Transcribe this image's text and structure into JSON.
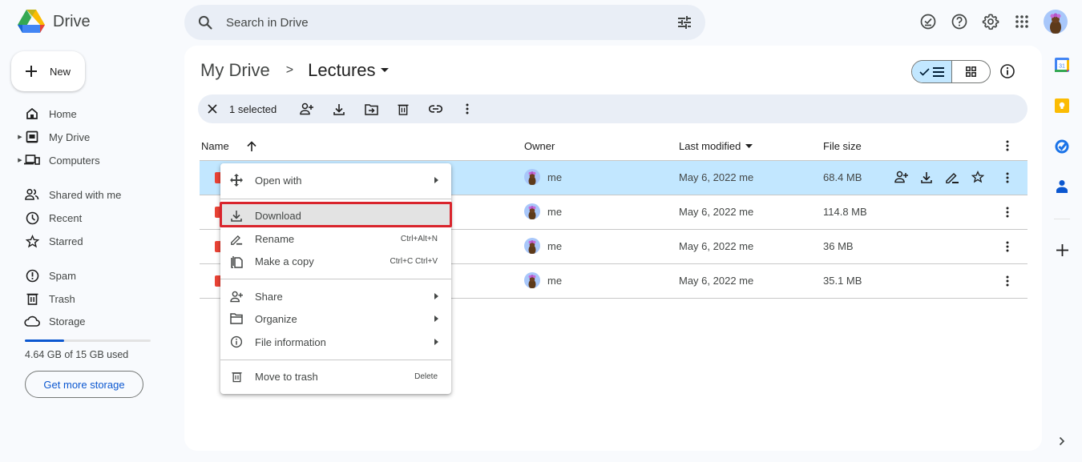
{
  "app": {
    "name": "Drive",
    "icons": {
      "logo": "google-drive-logo",
      "search": "search-icon",
      "filter": "tune-icon",
      "ready_offline": "offline-check-icon",
      "help": "help-icon",
      "settings": "gear-icon",
      "apps": "apps-grid-icon",
      "account": "avatar"
    }
  },
  "search": {
    "placeholder": "Search in Drive"
  },
  "sidebar": {
    "new_label": "New",
    "items": [
      {
        "label": "Home",
        "icon": "home-icon",
        "expandable": false
      },
      {
        "label": "My Drive",
        "icon": "my-drive-icon",
        "expandable": true
      },
      {
        "label": "Computers",
        "icon": "computers-icon",
        "expandable": true
      },
      {
        "label": "Shared with me",
        "icon": "shared-icon",
        "expandable": false
      },
      {
        "label": "Recent",
        "icon": "clock-icon",
        "expandable": false
      },
      {
        "label": "Starred",
        "icon": "star-icon",
        "expandable": false
      },
      {
        "label": "Spam",
        "icon": "spam-icon",
        "expandable": false
      },
      {
        "label": "Trash",
        "icon": "trash-icon",
        "expandable": false
      },
      {
        "label": "Storage",
        "icon": "cloud-icon",
        "expandable": false
      }
    ],
    "storage": {
      "used_fraction": 0.309,
      "text": "4.64 GB of 15 GB used",
      "button": "Get more storage"
    }
  },
  "breadcrumb": {
    "parent": "My Drive",
    "current": "Lectures"
  },
  "view": {
    "mode": "list"
  },
  "selection_bar": {
    "count_label": "1 selected",
    "actions": [
      "close",
      "share",
      "download",
      "move",
      "trash",
      "copy-link",
      "more"
    ]
  },
  "table": {
    "columns": {
      "name": "Name",
      "owner": "Owner",
      "modified": "Last modified",
      "size": "File size"
    },
    "rows": [
      {
        "owner": "me",
        "modified": "May 6, 2022 me",
        "size": "68.4 MB",
        "selected": true
      },
      {
        "owner": "me",
        "modified": "May 6, 2022 me",
        "size": "114.8 MB",
        "selected": false
      },
      {
        "owner": "me",
        "modified": "May 6, 2022 me",
        "size": "36 MB",
        "selected": false
      },
      {
        "owner": "me",
        "modified": "May 6, 2022 me",
        "size": "35.1 MB",
        "selected": false
      }
    ]
  },
  "context_menu": {
    "items": [
      {
        "label": "Open with",
        "icon": "open-with-icon",
        "shortcut": "",
        "submenu": true
      },
      {
        "label": "Download",
        "icon": "download-icon",
        "shortcut": "",
        "submenu": false,
        "highlighted": true
      },
      {
        "label": "Rename",
        "icon": "rename-icon",
        "shortcut": "Ctrl+Alt+N",
        "submenu": false
      },
      {
        "label": "Make a copy",
        "icon": "copy-icon",
        "shortcut": "Ctrl+C Ctrl+V",
        "submenu": false
      },
      {
        "label": "Share",
        "icon": "share-icon",
        "shortcut": "",
        "submenu": true
      },
      {
        "label": "Organize",
        "icon": "folder-icon",
        "shortcut": "",
        "submenu": true
      },
      {
        "label": "File information",
        "icon": "info-icon",
        "shortcut": "",
        "submenu": true
      },
      {
        "label": "Move to trash",
        "icon": "trash-icon",
        "shortcut": "Delete",
        "submenu": false
      }
    ]
  },
  "right_rail": {
    "apps": [
      "calendar-icon",
      "keep-icon",
      "tasks-icon",
      "contacts-icon",
      "add-icon",
      "expand-icon"
    ],
    "colors": {
      "keep": "#fbbc04",
      "tasks": "#1a73e8",
      "contacts": "#0b57d0"
    }
  },
  "colors": {
    "accent": "#0b57d0",
    "selected_row": "#c2e7ff",
    "highlight_outline": "#d9242c",
    "file_icon": "#ea4335"
  }
}
